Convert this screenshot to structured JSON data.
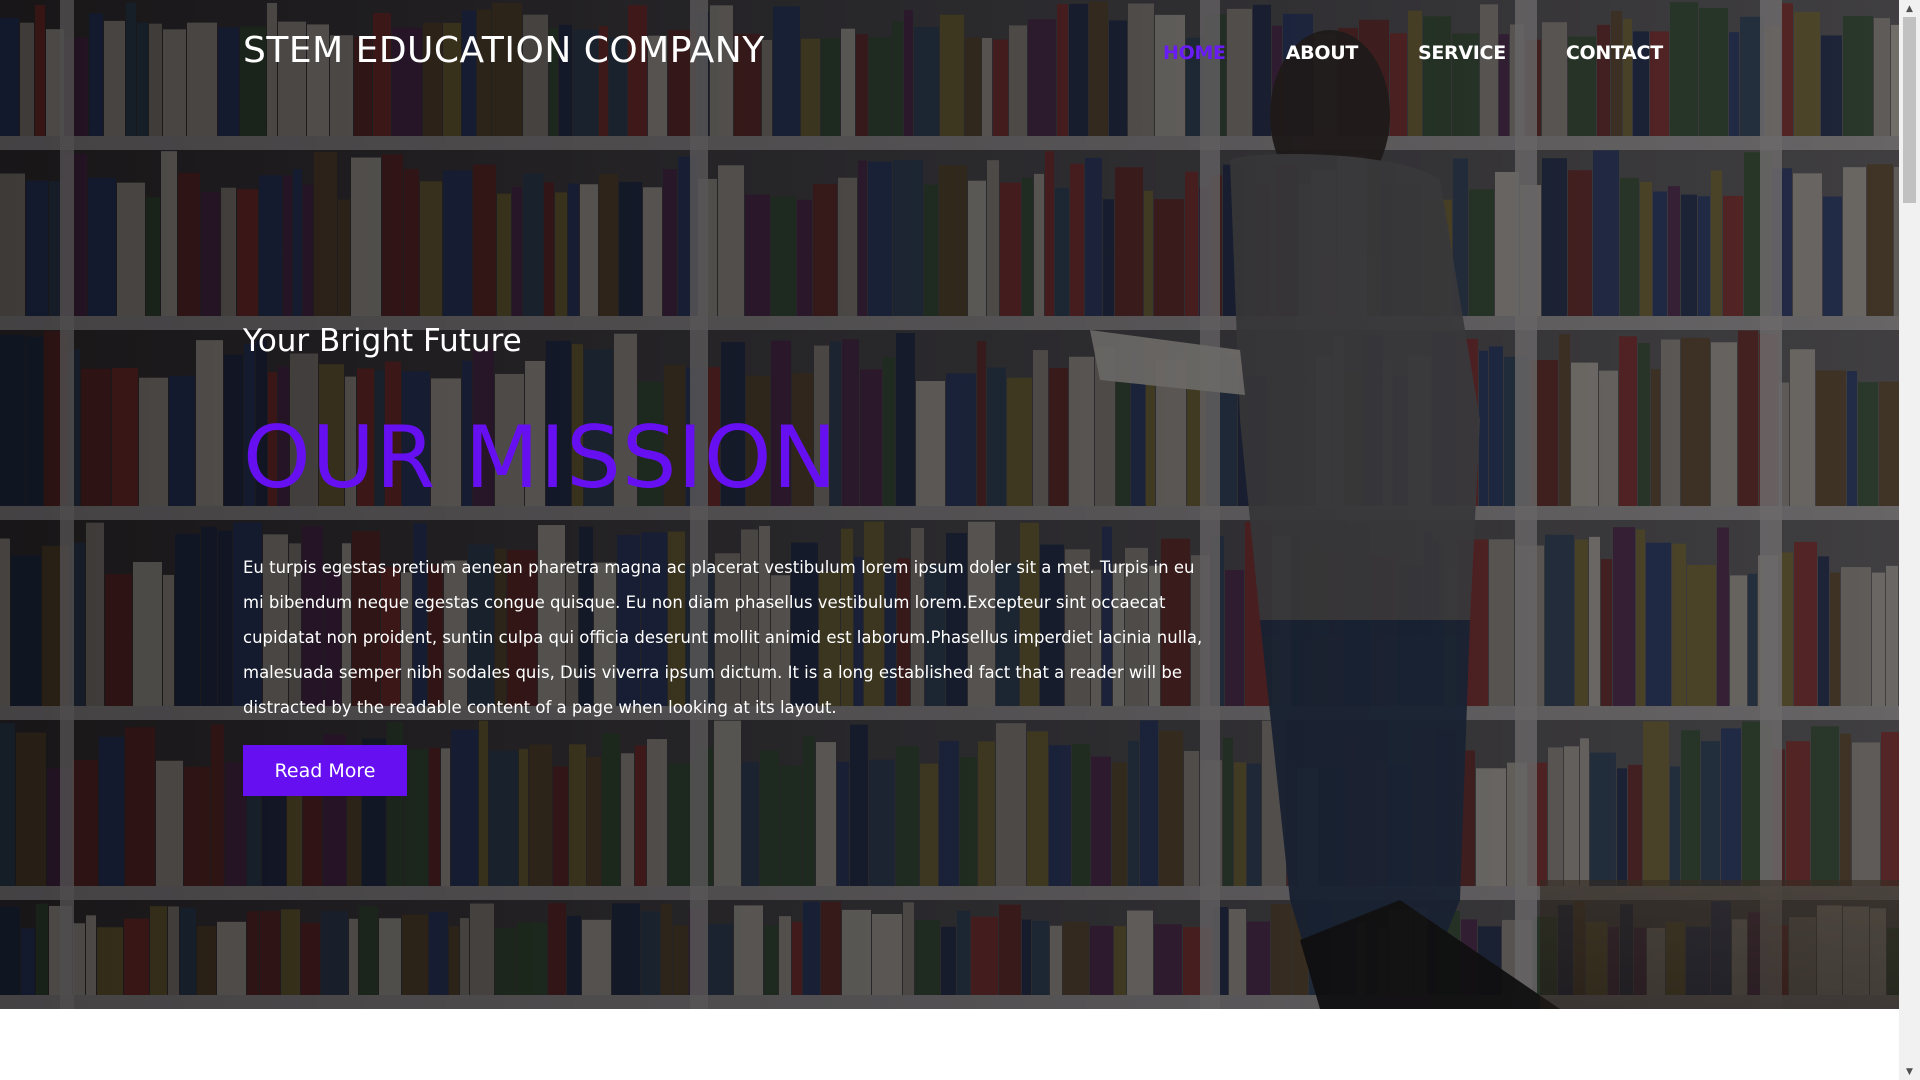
{
  "header": {
    "brand": "STEM EDUCATION COMPANY",
    "nav": [
      {
        "label": "HOME",
        "active": true
      },
      {
        "label": "ABOUT",
        "active": false
      },
      {
        "label": "SERVICE",
        "active": false
      },
      {
        "label": "CONTACT",
        "active": false
      }
    ]
  },
  "hero": {
    "tagline": "Your Bright Future",
    "heading": "OUR MISSION",
    "body": "Eu turpis egestas pretium aenean pharetra magna ac placerat vestibulum lorem ipsum doler sit a met. Turpis in eu mi bibendum neque egestas congue quisque. Eu non diam phasellus vestibulum lorem.Excepteur sint occaecat cupidatat non proident, suntin culpa qui officia deserunt mollit animid est laborum.Phasellus imperdiet lacinia nulla, malesuada semper nibh sodales quis, Duis viverra ipsum dictum. It is a long established fact that a reader will be distracted by the readable content of a page when looking at its layout.",
    "button_label": "Read More"
  },
  "colors": {
    "accent": "#6610f2",
    "active_nav": "#6a1cf6",
    "text": "#ffffff"
  },
  "icons": {
    "scroll_up": "triangle-up-icon",
    "scroll_down": "triangle-down-icon"
  }
}
